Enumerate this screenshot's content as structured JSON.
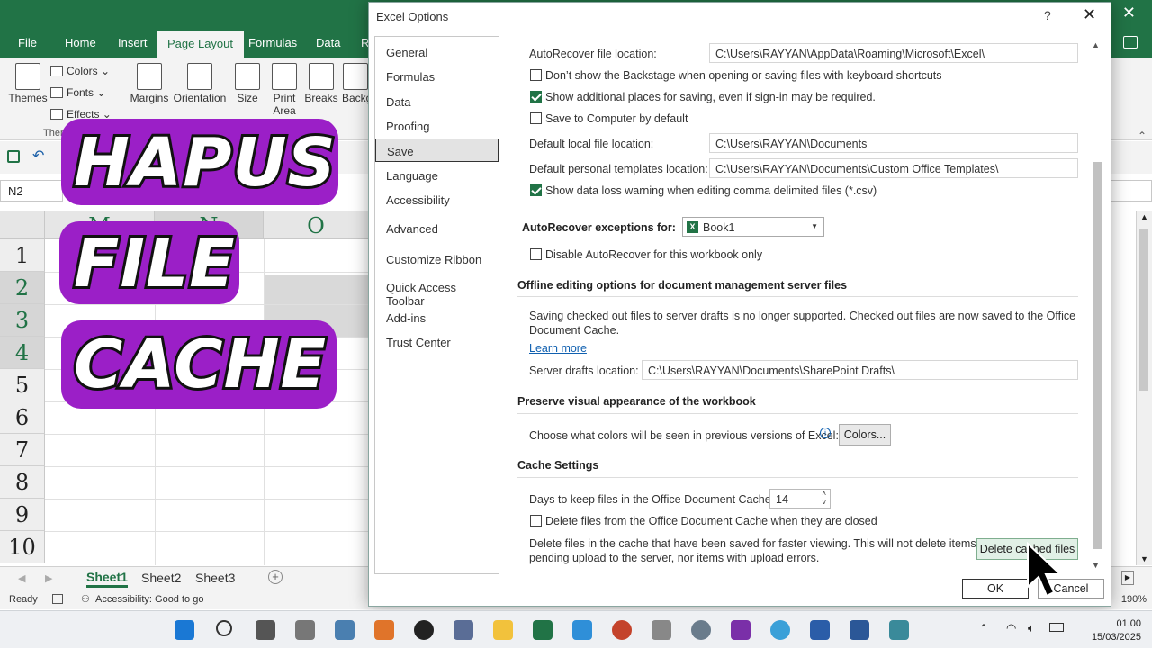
{
  "excel": {
    "tabs": [
      "File",
      "Home",
      "Insert",
      "Page Layout",
      "Formulas",
      "Data",
      "R"
    ],
    "ribbon": {
      "themes": "Themes",
      "colors": "Colors",
      "fonts": "Fonts",
      "effects": "Effects",
      "group_themes": "Theme",
      "margins": "Margins",
      "orientation": "Orientation",
      "size": "Size",
      "print_area_1": "Print",
      "print_area_2": "Area",
      "breaks": "Breaks",
      "background": "Backg"
    },
    "name_box": "N2",
    "columns": [
      "M",
      "N",
      "O"
    ],
    "rows": [
      "1",
      "2",
      "3",
      "4",
      "5",
      "6",
      "7",
      "8",
      "9",
      "10"
    ],
    "sheets": [
      "Sheet1",
      "Sheet2",
      "Sheet3"
    ],
    "status": {
      "ready": "Ready",
      "accessibility": "Accessibility: Good to go",
      "zoom": "190%"
    },
    "accent_color": "#217346"
  },
  "overlay": {
    "line1": "HAPUS",
    "line2": "FILE",
    "line3": "CACHE",
    "bg_color": "#9b1fc7"
  },
  "dialog": {
    "title": "Excel Options",
    "help": "?",
    "nav": [
      "General",
      "Formulas",
      "Data",
      "Proofing",
      "Save",
      "Language",
      "Accessibility",
      "Advanced",
      "Customize Ribbon",
      "Quick Access Toolbar",
      "Add-ins",
      "Trust Center"
    ],
    "active_nav": "Save",
    "autorecover_location_label": "AutoRecover file location:",
    "autorecover_location_value": "C:\\Users\\RAYYAN\\AppData\\Roaming\\Microsoft\\Excel\\",
    "opt_backstage": "Don’t show the Backstage when opening or saving files with keyboard shortcuts",
    "opt_additional_places": "Show additional places for saving, even if sign-in may be required.",
    "opt_save_computer": "Save to Computer by default",
    "default_local_label": "Default local file location:",
    "default_local_value": "C:\\Users\\RAYYAN\\Documents",
    "default_templates_label": "Default personal templates location:",
    "default_templates_value": "C:\\Users\\RAYYAN\\Documents\\Custom Office Templates\\",
    "opt_data_loss": "Show data loss warning when editing comma delimited files (*.csv)",
    "exceptions_label": "AutoRecover exceptions for:",
    "exceptions_value": "Book1",
    "opt_disable_autorecover": "Disable AutoRecover for this workbook only",
    "offline_header": "Offline editing options for document management server files",
    "offline_text_1": "Saving checked out files to server drafts is no longer supported. Checked out files are now saved to the Office",
    "offline_text_2": "Document Cache.",
    "learn_more": "Learn more",
    "server_drafts_label": "Server drafts location:",
    "server_drafts_value": "C:\\Users\\RAYYAN\\Documents\\SharePoint Drafts\\",
    "preserve_header": "Preserve visual appearance of the workbook",
    "colors_text": "Choose what colors will be seen in previous versions of Excel:",
    "colors_button": "Colors...",
    "cache_header": "Cache Settings",
    "days_label": "Days to keep files in the Office Document Cache:",
    "days_value": "14",
    "opt_delete_closed": "Delete files from the Office Document Cache when they are closed",
    "delete_text_1": "Delete files in the cache that have been saved for faster viewing. This will not delete items",
    "delete_text_2": "pending upload to the server, nor items with upload errors.",
    "delete_button": "Delete cached files",
    "ok": "OK",
    "cancel": "Cancel"
  },
  "taskbar": {
    "time": "01.00",
    "date": "15/03/2025"
  }
}
